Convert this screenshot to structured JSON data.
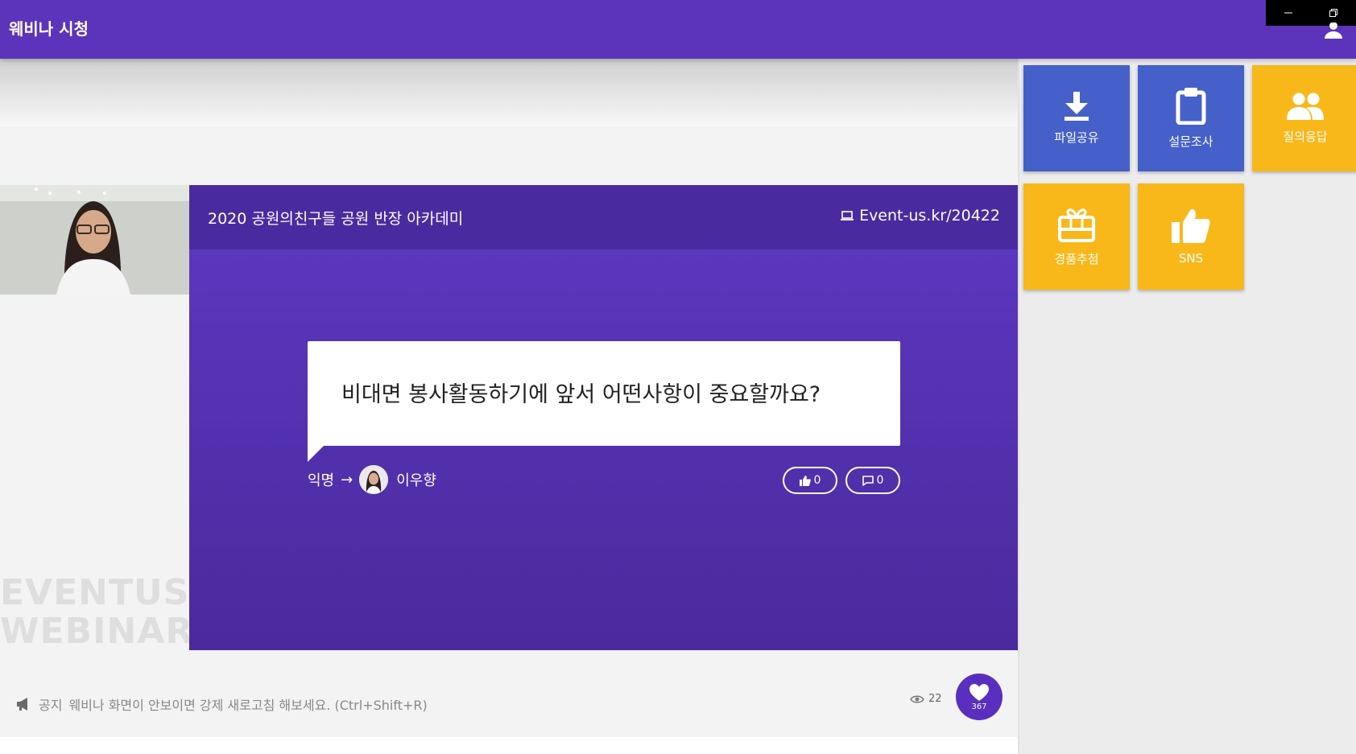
{
  "app": {
    "title": "웨비나 시청"
  },
  "session": {
    "event_title": "2020 공원의친구들 공원 반장 아카데미",
    "event_url": "Event-us.kr/20422"
  },
  "question": {
    "text": "비대면 봉사활동하기에 앞서 어떤사항이 중요할까요?",
    "asker": "익명",
    "arrow": "→",
    "presenter": "이우향",
    "likes": "0",
    "comments": "0"
  },
  "watermark": {
    "line1": "EVENTUS",
    "line2": "WEBINAR"
  },
  "notice": {
    "label": "공지",
    "text": "웨비나 화면이 안보이면 강제 새로고침 해보세요. (Ctrl+Shift+R)"
  },
  "stats": {
    "views": "22",
    "hearts": "367"
  },
  "tiles": [
    {
      "label": "파일공유",
      "icon": "download-icon"
    },
    {
      "label": "설문조사",
      "icon": "clipboard-icon"
    },
    {
      "label": "질의응답",
      "icon": "people-icon"
    },
    {
      "label": "경품추첨",
      "icon": "gift-icon"
    },
    {
      "label": "SNS",
      "icon": "thumbs-up-icon"
    }
  ],
  "colors": {
    "header": "#5c34bb",
    "slide": "#5d39c3",
    "tile_blue": "#4560c8",
    "tile_yellow": "#f8b81a"
  }
}
